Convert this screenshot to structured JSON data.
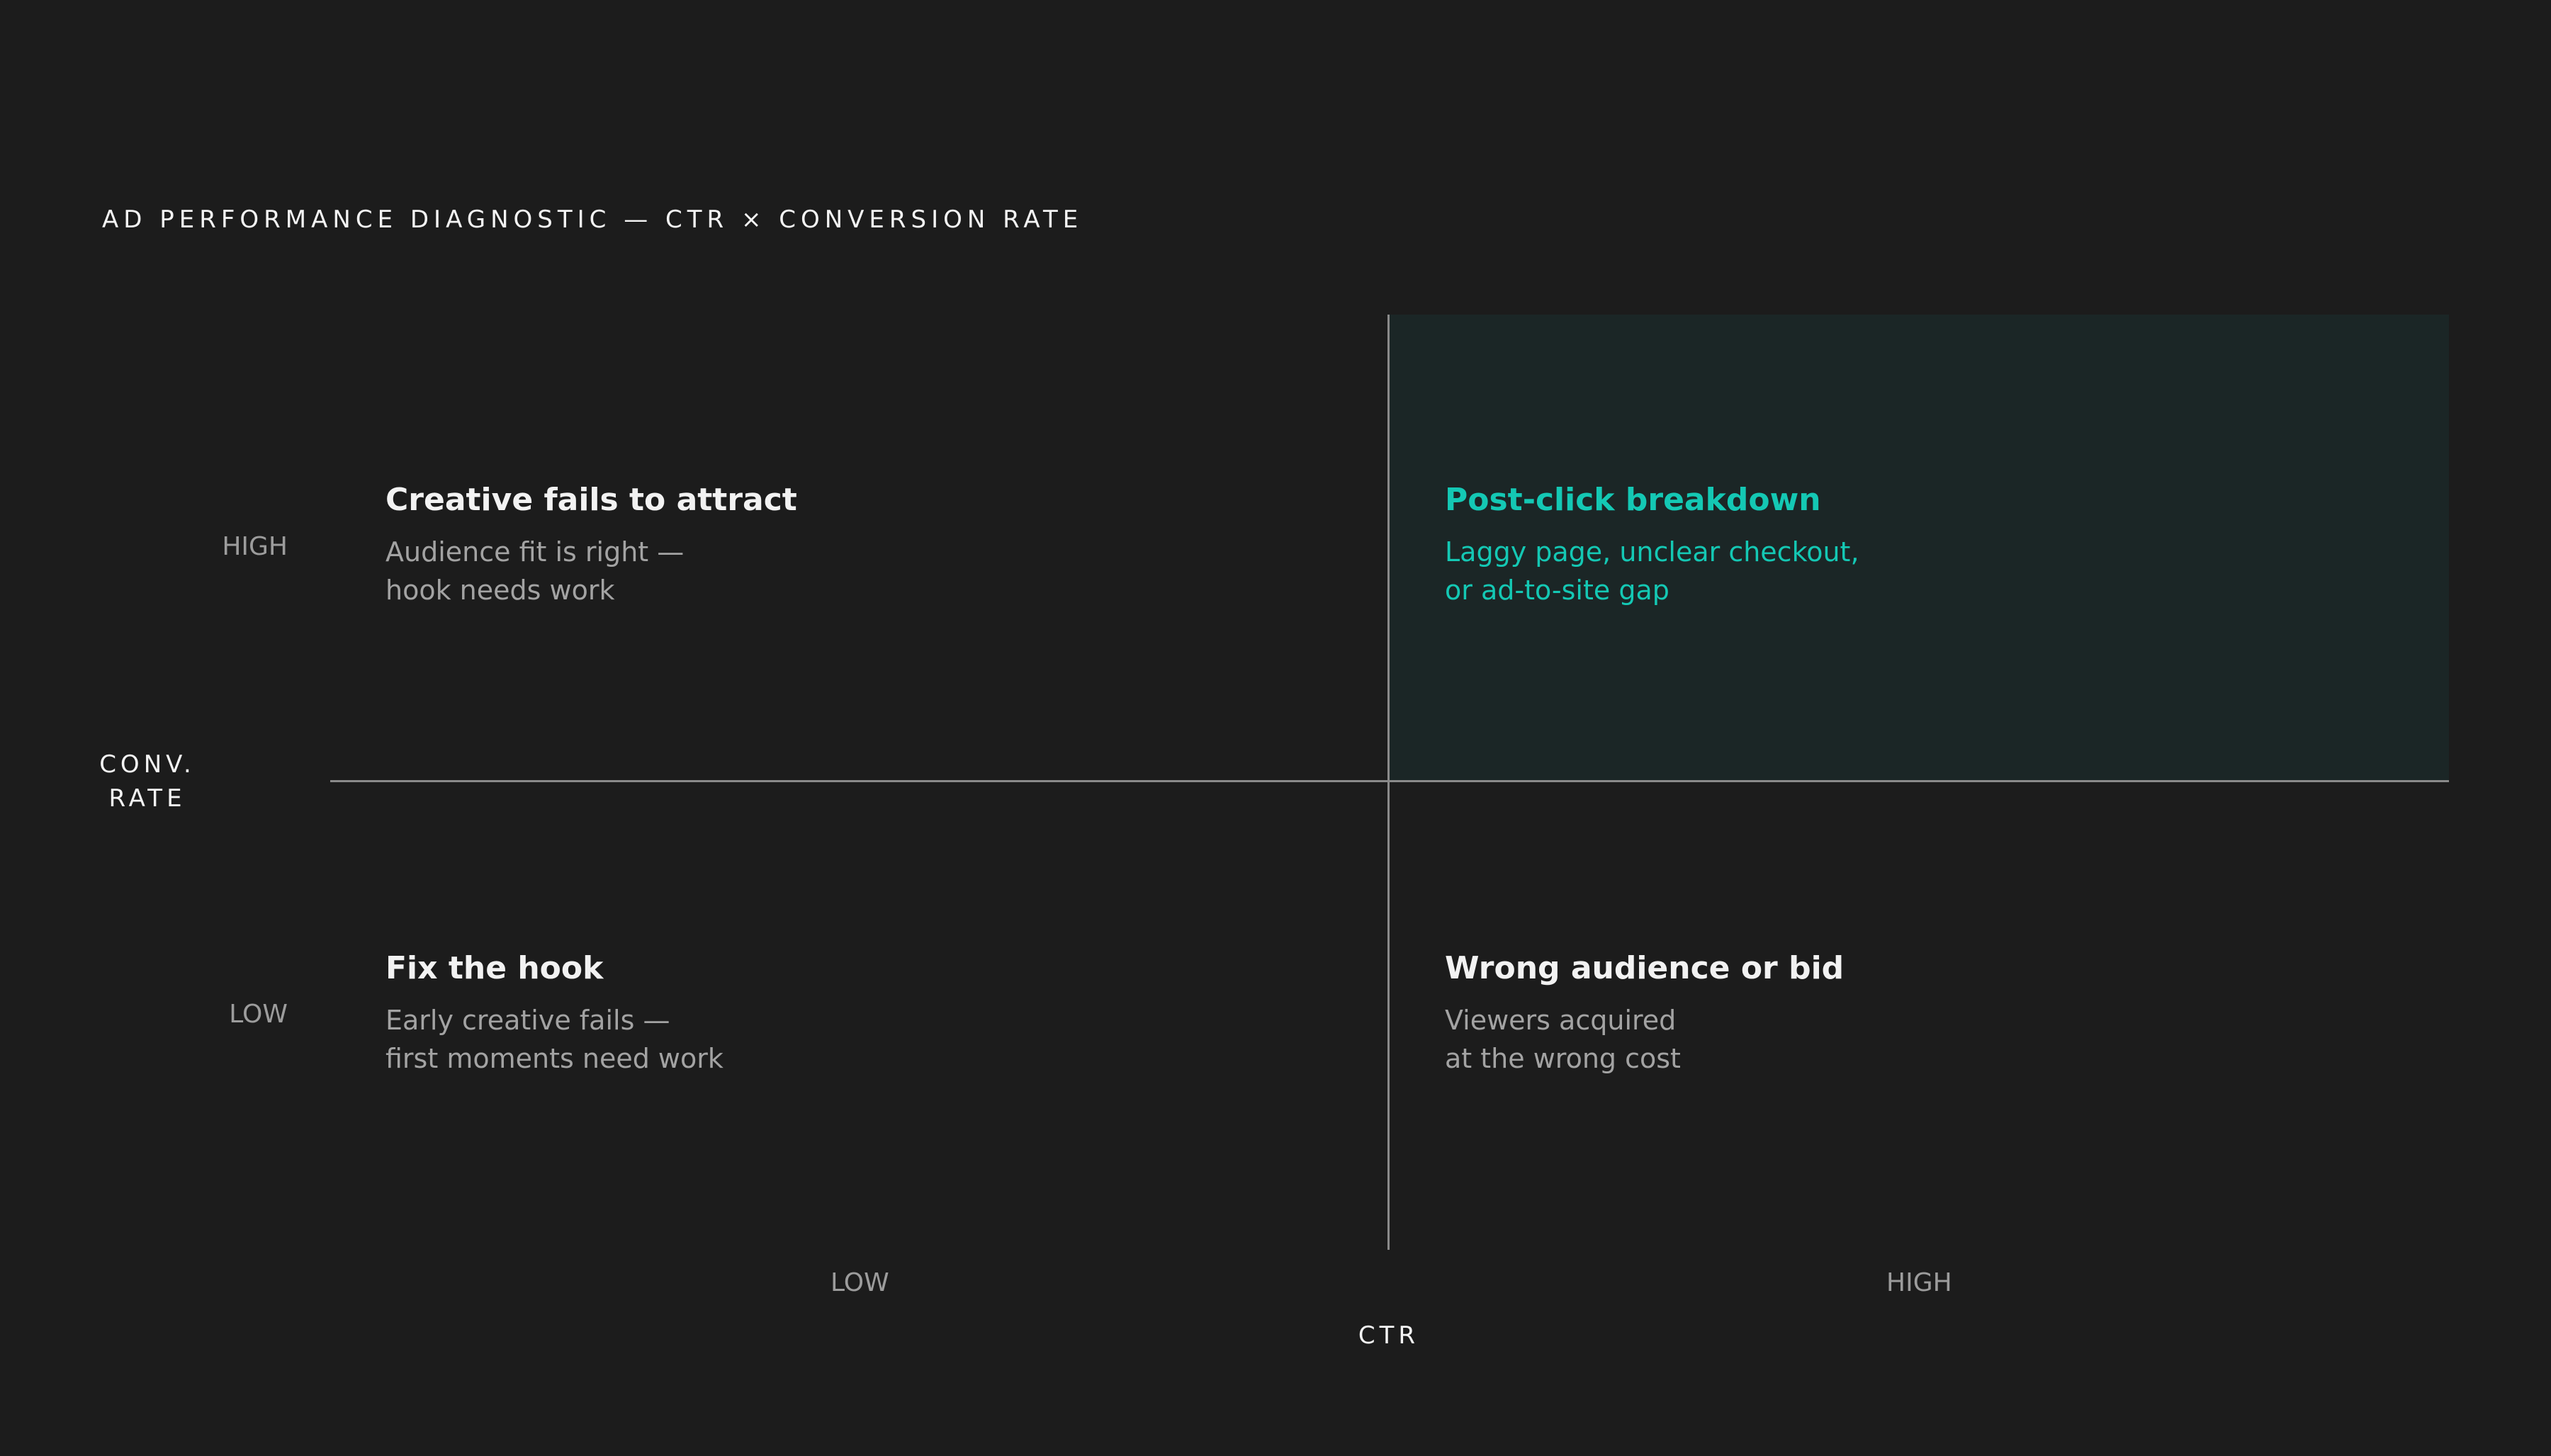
{
  "title": "AD PERFORMANCE DIAGNOSTIC — CTR × CONVERSION RATE",
  "colors": {
    "background": "#1c1c1c",
    "accent": "#14c8b4",
    "highlight_quadrant_fill": "#1b2626",
    "axis_line": "#8a8a8a",
    "muted_text": "#a3a3a3"
  },
  "y_axis": {
    "label_line1": "CONV.",
    "label_line2": "RATE",
    "high": "HIGH",
    "low": "LOW"
  },
  "x_axis": {
    "label": "CTR",
    "low": "LOW",
    "high": "HIGH"
  },
  "quadrants": {
    "low_ctr_high_conv": {
      "title": "Creative fails to attract",
      "desc_line1": "Audience fit is right —",
      "desc_line2": "hook needs work"
    },
    "high_ctr_high_conv": {
      "title": "Post-click breakdown",
      "desc_line1": "Laggy page, unclear checkout,",
      "desc_line2": "or ad-to-site gap",
      "highlighted": true
    },
    "low_ctr_low_conv": {
      "title": "Fix the hook",
      "desc_line1": "Early creative fails —",
      "desc_line2": "first moments need work"
    },
    "high_ctr_low_conv": {
      "title": "Wrong audience or bid",
      "desc_line1": "Viewers acquired",
      "desc_line2": "at the wrong cost"
    }
  }
}
